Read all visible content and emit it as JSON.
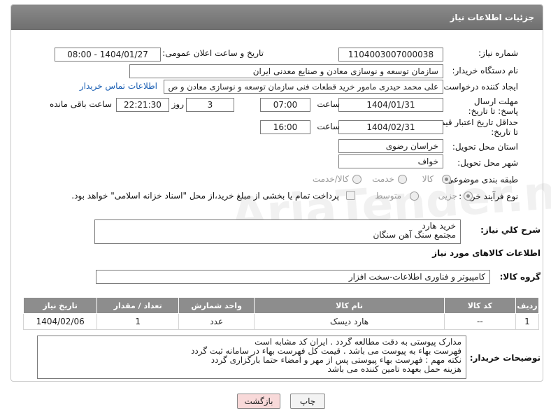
{
  "header": {
    "title": "جزئیات اطلاعات نیاز"
  },
  "labels": {
    "need_number": "شماره نیاز:",
    "announce_datetime": "تاریخ و ساعت اعلان عمومی:",
    "buyer_org": "نام دستگاه خریدار:",
    "requester": "ایجاد کننده درخواست:",
    "reply_deadline": "مهلت ارسال پاسخ: تا تاریخ:",
    "time": "ساعت",
    "day_and": "روز و",
    "remaining": "ساعت باقی مانده",
    "min_price_validity": "حداقل تاریخ اعتبار قیمت: تا تاریخ:",
    "delivery_province": "استان محل تحویل:",
    "delivery_city": "شهر محل تحویل:",
    "subject_class": "طبقه بندی موضوعی:",
    "process_type": "نوع فرآیند خرید :",
    "general_desc": "شرح کلي نياز:",
    "goods_info": "اطلاعات کالاهای مورد نیاز",
    "goods_group": "گروه کالا:",
    "buyer_notes": "توضیحات خریدار:"
  },
  "fields": {
    "need_number": "1104003007000038",
    "announce_datetime": "1404/01/27 - 08:00",
    "buyer_org": "سازمان توسعه و نوسازی معادن و صنايع معدنی ايران",
    "requester": "علی محمد حیدری مامور خرید قطعات فنی سازمان توسعه و نوسازی معادن و ص",
    "buyer_contact_link": "اطلاعات تماس خریدار",
    "reply_date": "1404/01/31",
    "reply_time": "07:00",
    "reply_days": "3",
    "reply_remaining": "22:21:30",
    "validity_date": "1404/02/31",
    "validity_time": "16:00",
    "province": "خراسان رضوی",
    "city": "خواف"
  },
  "subject_options": [
    "کالا",
    "خدمت",
    "کالا/خدمت"
  ],
  "subject_selected": "کالا",
  "process_options": [
    "جزیی",
    "متوسط"
  ],
  "process_selected": "جزیی",
  "payment_note": "پرداخت تمام یا بخشی از مبلغ خرید،از محل \"اسناد خزانه اسلامی\" خواهد بود.",
  "general_desc_lines": [
    "خرید هارد",
    "مجتمع سنگ آهن سنگان"
  ],
  "goods_group": "کامپیوتر و فناوری اطلاعات-سخت افزار",
  "table": {
    "headers": [
      "ردیف",
      "کد کالا",
      "نام کالا",
      "واحد شمارش",
      "تعداد / مقدار",
      "تاریخ نیاز"
    ],
    "rows": [
      [
        "1",
        "--",
        "هارد دیسک",
        "عدد",
        "1",
        "1404/02/06"
      ]
    ]
  },
  "notes_lines": [
    "مدارک پیوستی به دقت مطالعه گردد . ایران کد مشابه است",
    "فهرست بهاء به پیوست می باشد . قیمت کل فهرست بهاء در سامانه ثبت گردد",
    "نکته مهم : فهرست بهاء پیوستی پس از مهر و امضاء حتما بارگزاری گردد",
    "هزینه حمل بعهده تامین کننده می باشد"
  ],
  "buttons": {
    "print": "چاپ",
    "back": "بازگشت"
  },
  "watermark": "AriaTender.neT",
  "colors": {
    "header_bg": "#7c7c7c",
    "link": "#1a5fb4",
    "back_button_bg": "#f8d9d9"
  }
}
